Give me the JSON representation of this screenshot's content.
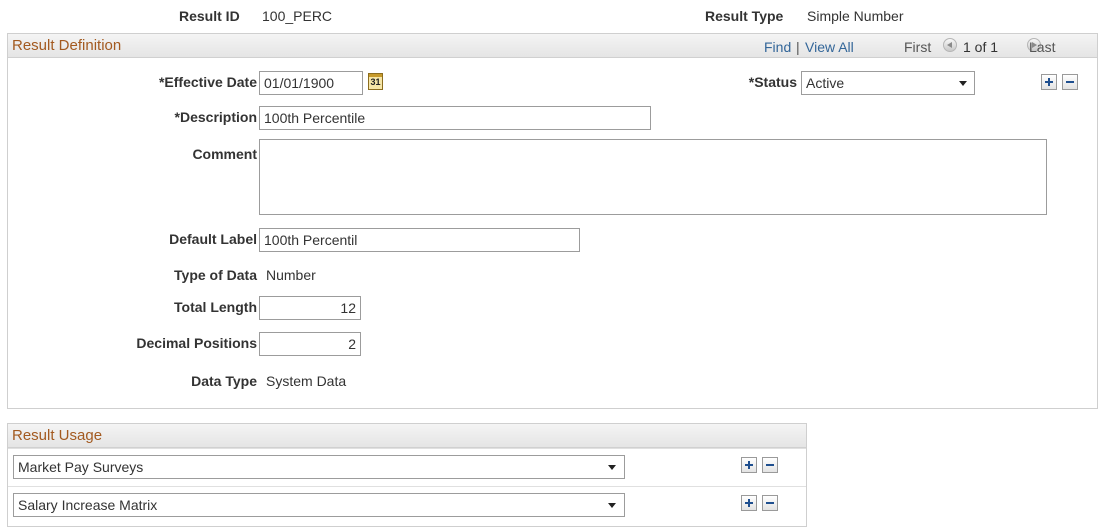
{
  "header": {
    "result_id_label": "Result ID",
    "result_id_value": "100_PERC",
    "result_type_label": "Result Type",
    "result_type_value": "Simple Number"
  },
  "definition": {
    "title": "Result Definition",
    "find": "Find",
    "separator": "|",
    "view_all": "View All",
    "first": "First",
    "page_of": "1 of 1",
    "last": "Last",
    "effective_date_label": "*Effective Date",
    "effective_date_value": "01/01/1900",
    "calendar_text": "31",
    "status_label": "*Status",
    "status_value": "Active",
    "description_label": "*Description",
    "description_value": "100th Percentile",
    "comment_label": "Comment",
    "comment_value": "",
    "default_label_label": "Default Label",
    "default_label_value": "100th Percentil",
    "type_of_data_label": "Type of Data",
    "type_of_data_value": "Number",
    "total_length_label": "Total Length",
    "total_length_value": "12",
    "decimal_positions_label": "Decimal Positions",
    "decimal_positions_value": "2",
    "data_type_label": "Data Type",
    "data_type_value": "System Data"
  },
  "usage": {
    "title": "Result Usage",
    "rows": [
      {
        "value": "Market Pay Surveys"
      },
      {
        "value": "Salary Increase Matrix"
      }
    ]
  },
  "colors": {
    "group_title": "#a35a20",
    "link": "#336699",
    "button_icon": "#1f4f8f"
  },
  "icons": {
    "calendar": "calendar-icon",
    "add": "add-row-icon",
    "delete": "delete-row-icon",
    "prev": "previous-icon",
    "next": "next-icon",
    "dropdown": "chevron-down-icon"
  }
}
